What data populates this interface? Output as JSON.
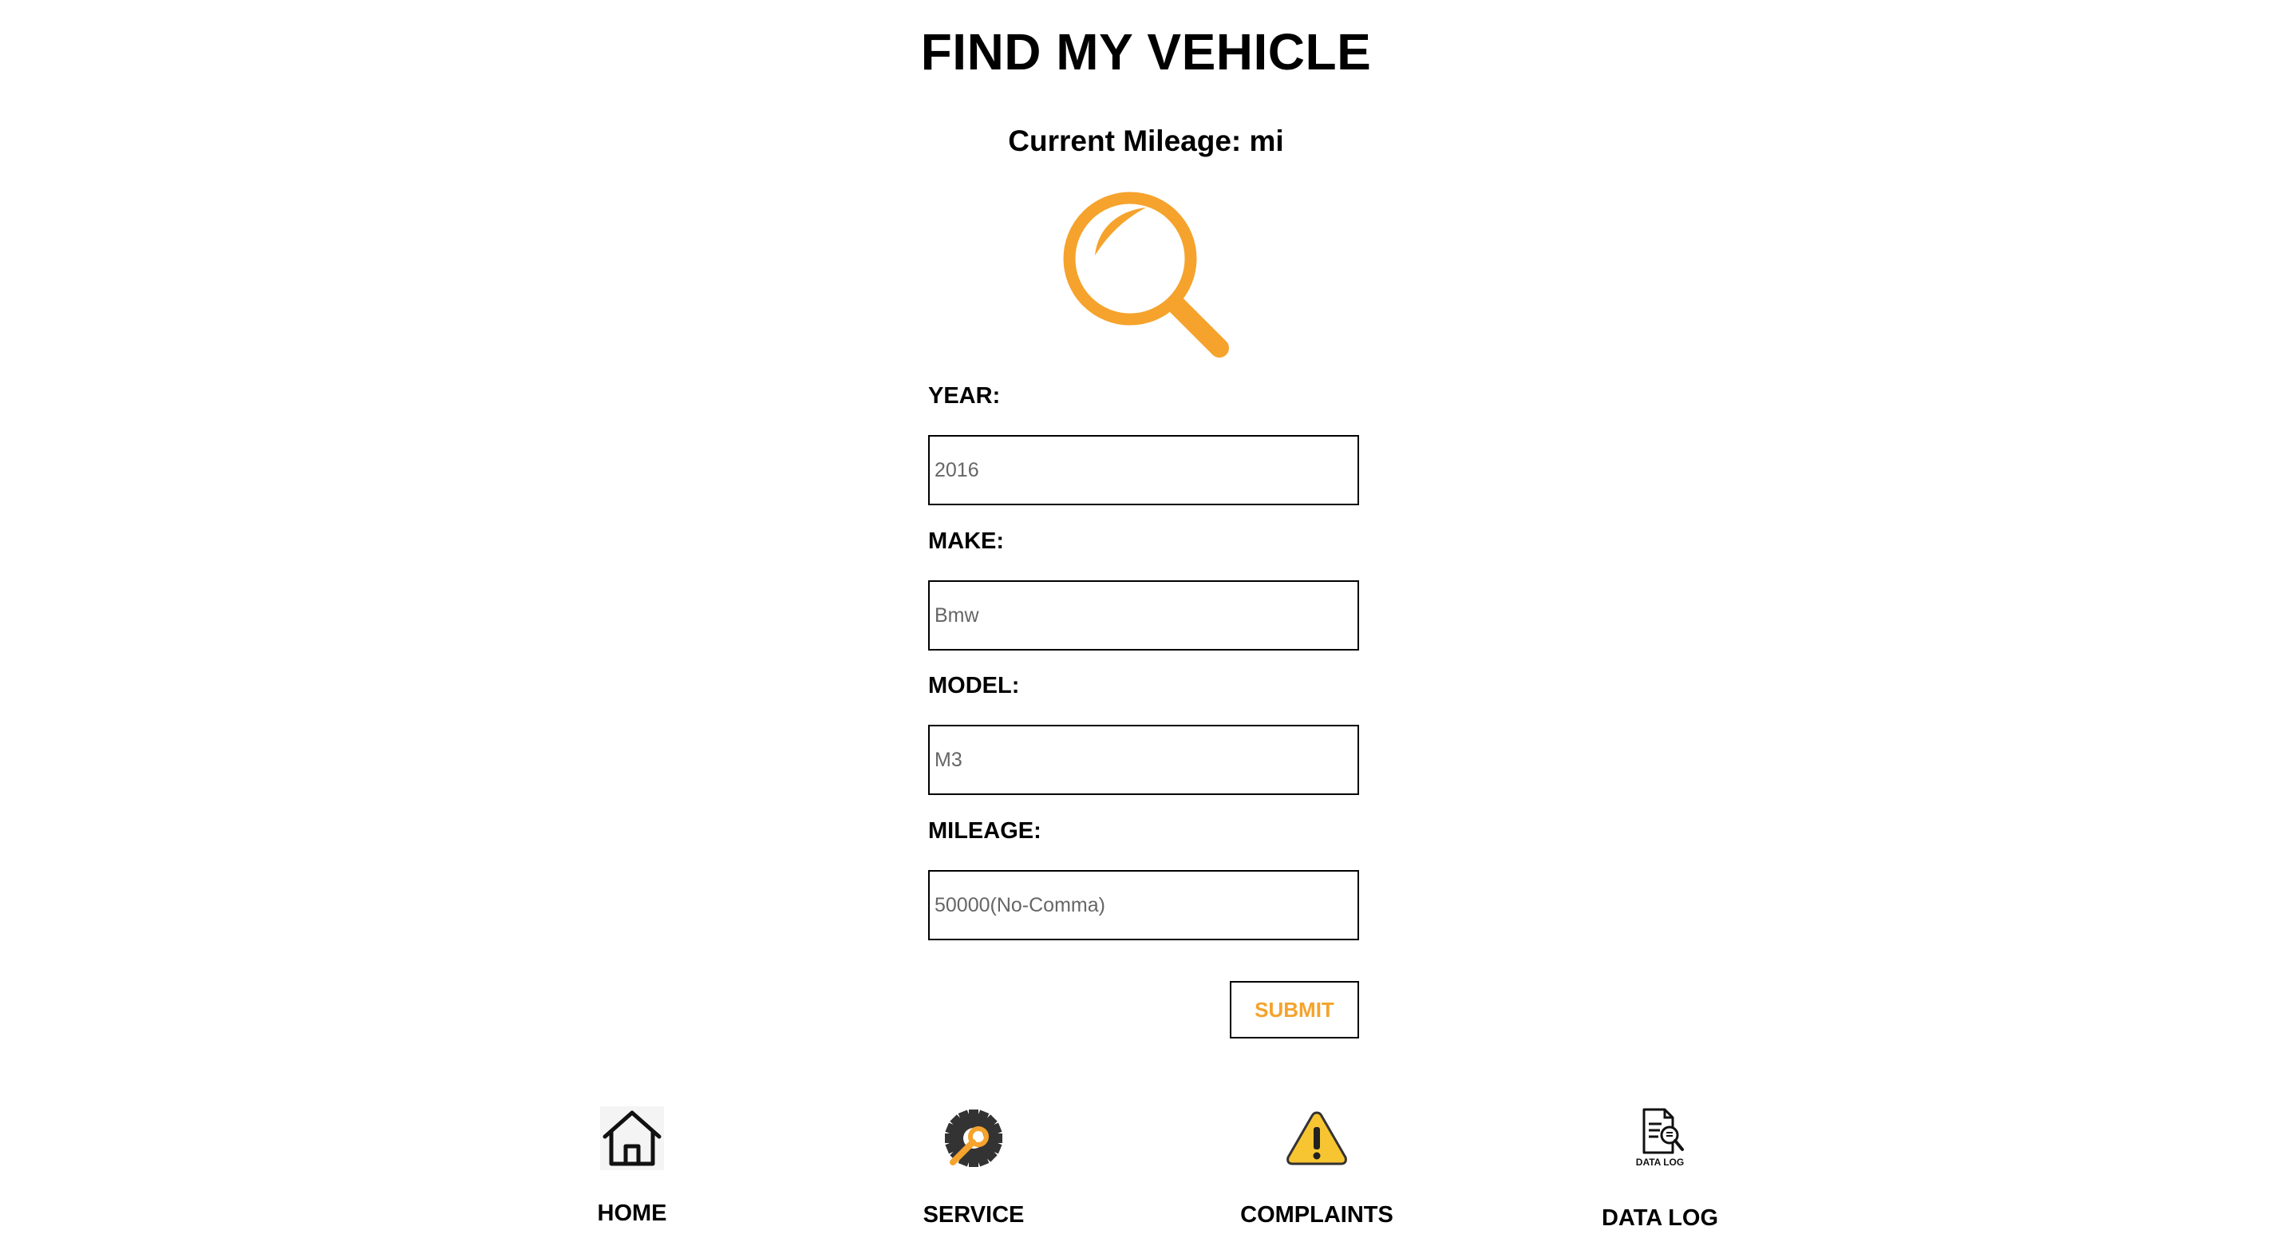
{
  "header": {
    "title": "FIND MY VEHICLE",
    "mileage_text": "Current Mileage: mi"
  },
  "form": {
    "year": {
      "label": "YEAR:",
      "placeholder": "2016"
    },
    "make": {
      "label": "MAKE:",
      "placeholder": "Bmw"
    },
    "model": {
      "label": "MODEL:",
      "placeholder": "M3"
    },
    "mileage": {
      "label": "MILEAGE:",
      "placeholder": "50000(No-Comma)"
    },
    "submit_label": "SUBMIT"
  },
  "nav": {
    "home": {
      "label": "HOME",
      "icon": "house-icon"
    },
    "service": {
      "label": "SERVICE",
      "icon": "gear-wrench-icon"
    },
    "complaints": {
      "label": "COMPLAINTS",
      "icon": "warning-icon"
    },
    "data_log": {
      "label": "DATA LOG",
      "icon": "data-log-icon",
      "icon_text": "DATA LOG"
    }
  },
  "colors": {
    "accent": "#f5a32c",
    "warning": "#f7c531"
  }
}
